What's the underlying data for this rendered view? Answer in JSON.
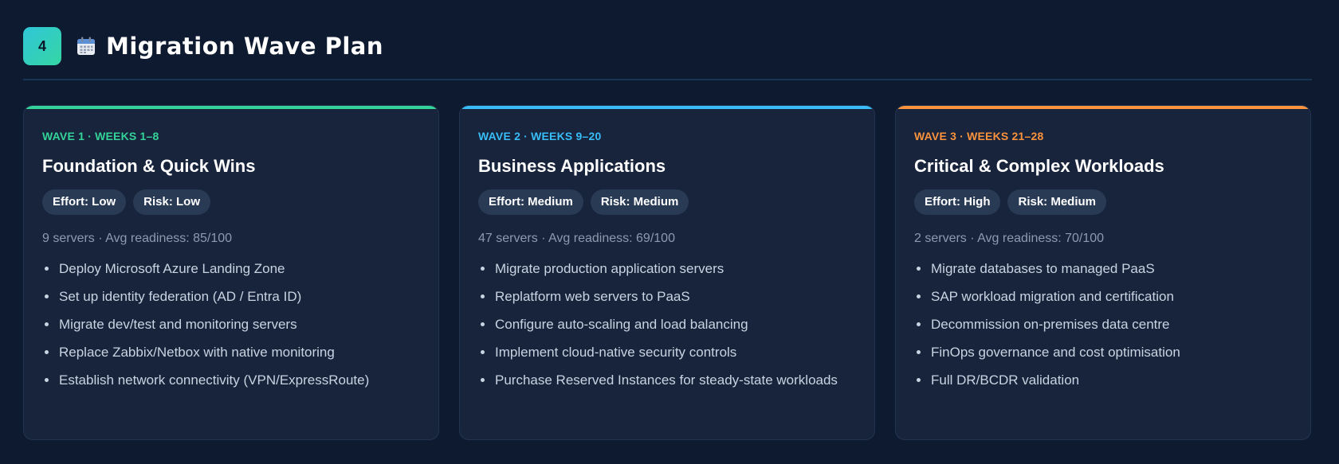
{
  "section": {
    "number": "4",
    "icon": "calendar-icon",
    "title": "Migration Wave Plan"
  },
  "waves": [
    {
      "label": "WAVE 1 · WEEKS 1–8",
      "accent": "#34d399",
      "title": "Foundation & Quick Wins",
      "effort": "Effort: Low",
      "risk": "Risk: Low",
      "stats": "9 servers · Avg readiness: 85/100",
      "items": [
        "Deploy Microsoft Azure Landing Zone",
        "Set up identity federation (AD / Entra ID)",
        "Migrate dev/test and monitoring servers",
        "Replace Zabbix/Netbox with native monitoring",
        "Establish network connectivity (VPN/ExpressRoute)"
      ]
    },
    {
      "label": "WAVE 2 · WEEKS 9–20",
      "accent": "#38bdf8",
      "title": "Business Applications",
      "effort": "Effort: Medium",
      "risk": "Risk: Medium",
      "stats": "47 servers · Avg readiness: 69/100",
      "items": [
        "Migrate production application servers",
        "Replatform web servers to PaaS",
        "Configure auto-scaling and load balancing",
        "Implement cloud-native security controls",
        "Purchase Reserved Instances for steady-state workloads"
      ]
    },
    {
      "label": "WAVE 3 · WEEKS 21–28",
      "accent": "#fb923c",
      "title": "Critical & Complex Workloads",
      "effort": "Effort: High",
      "risk": "Risk: Medium",
      "stats": "2 servers · Avg readiness: 70/100",
      "items": [
        "Migrate databases to managed PaaS",
        "SAP workload migration and certification",
        "Decommission on-premises data centre",
        "FinOps governance and cost optimisation",
        "Full DR/BCDR validation"
      ]
    }
  ]
}
